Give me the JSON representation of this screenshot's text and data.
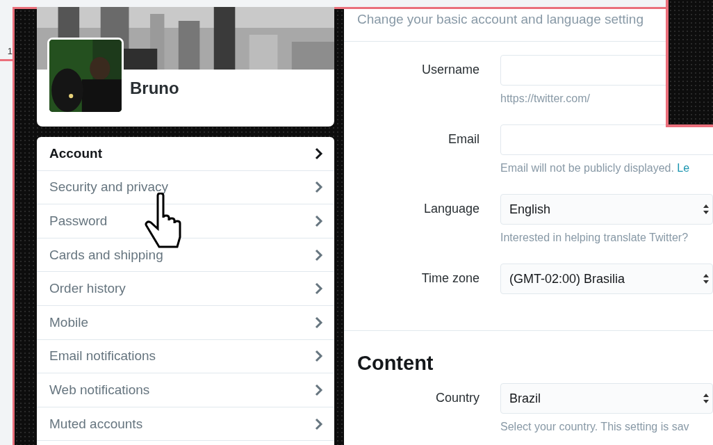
{
  "edge_fragment": "1",
  "profile": {
    "name": "Bruno"
  },
  "menu": [
    {
      "label": "Account",
      "selected": true
    },
    {
      "label": "Security and privacy",
      "selected": false
    },
    {
      "label": "Password",
      "selected": false
    },
    {
      "label": "Cards and shipping",
      "selected": false
    },
    {
      "label": "Order history",
      "selected": false
    },
    {
      "label": "Mobile",
      "selected": false
    },
    {
      "label": "Email notifications",
      "selected": false
    },
    {
      "label": "Web notifications",
      "selected": false
    },
    {
      "label": "Muted accounts",
      "selected": false
    }
  ],
  "subtitle": "Change your basic account and language setting",
  "fields": [
    {
      "label": "Username",
      "kind": "input",
      "help": "https://twitter.com/"
    },
    {
      "label": "Email",
      "kind": "input",
      "help": "Email will not be publicly displayed.",
      "help_link": "Le"
    },
    {
      "label": "Language",
      "kind": "select",
      "value": "English",
      "help": "Interested in helping translate Twitter?"
    },
    {
      "label": "Time zone",
      "kind": "select",
      "value": "(GMT-02:00) Brasilia"
    }
  ],
  "content_section": {
    "heading": "Content",
    "fields": [
      {
        "label": "Country",
        "kind": "select",
        "value": "Brazil",
        "help": "Select your country. This setting is sav"
      }
    ]
  }
}
